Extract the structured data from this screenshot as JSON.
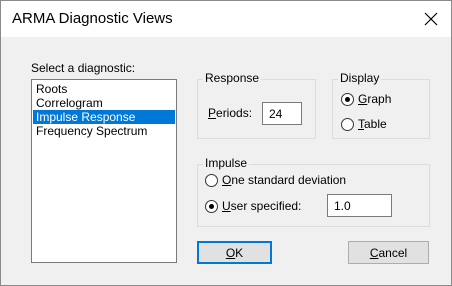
{
  "window": {
    "title": "ARMA Diagnostic Views",
    "close_icon": "close-icon"
  },
  "diagnostic": {
    "label": "Select a diagnostic:",
    "items": [
      "Roots",
      "Correlogram",
      "Impulse Response",
      "Frequency Spectrum"
    ],
    "selected_index": 2
  },
  "response": {
    "group_label": "Response",
    "periods_label_mnemonic": "P",
    "periods_label_rest": "eriods:",
    "periods_value": "24"
  },
  "display": {
    "group_label": "Display",
    "options": [
      {
        "mnemonic": "G",
        "rest": "raph",
        "checked": true
      },
      {
        "mnemonic": "T",
        "rest": "able",
        "checked": false
      }
    ]
  },
  "impulse": {
    "group_label": "Impulse",
    "options": [
      {
        "mnemonic": "O",
        "rest": "ne standard deviation",
        "checked": false
      },
      {
        "mnemonic": "U",
        "rest": "ser specified:",
        "checked": true
      }
    ],
    "user_value": "1.0"
  },
  "buttons": {
    "ok_mnemonic": "O",
    "ok_rest": "K",
    "cancel_mnemonic": "C",
    "cancel_rest": "ancel"
  },
  "colors": {
    "selection": "#0078d7",
    "dialog_bg": "#f0f0f0",
    "default_button_border": "#0078d7"
  }
}
